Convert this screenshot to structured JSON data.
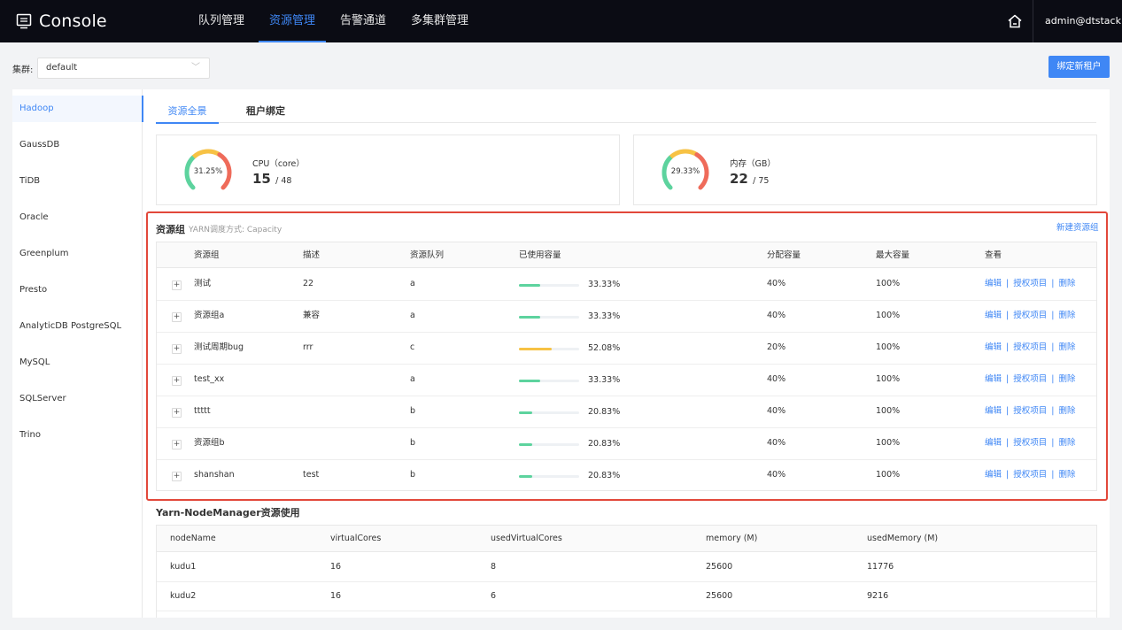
{
  "header": {
    "brand": "Console",
    "nav": [
      {
        "label": "队列管理",
        "active": false
      },
      {
        "label": "资源管理",
        "active": true
      },
      {
        "label": "告警通道",
        "active": false
      },
      {
        "label": "多集群管理",
        "active": false
      }
    ],
    "home_icon": "home-icon",
    "user": "admin@dtstack..."
  },
  "cluster": {
    "label": "集群:",
    "selected": "default",
    "bind_button": "绑定新租户"
  },
  "sidebar": {
    "items": [
      {
        "label": "Hadoop",
        "active": true
      },
      {
        "label": "GaussDB",
        "active": false
      },
      {
        "label": "TiDB",
        "active": false
      },
      {
        "label": "Oracle",
        "active": false
      },
      {
        "label": "Greenplum",
        "active": false
      },
      {
        "label": "Presto",
        "active": false
      },
      {
        "label": "AnalyticDB PostgreSQL",
        "active": false
      },
      {
        "label": "MySQL",
        "active": false
      },
      {
        "label": "SQLServer",
        "active": false
      },
      {
        "label": "Trino",
        "active": false
      }
    ]
  },
  "tabs": [
    {
      "label": "资源全景",
      "active": true
    },
    {
      "label": "租户绑定",
      "active": false
    }
  ],
  "metrics": [
    {
      "label": "CPU（core）",
      "used": "15",
      "total": "/ 48",
      "percent_text": "31.25%",
      "percent": 31.25
    },
    {
      "label": "内存（GB）",
      "used": "22",
      "total": "/ 75",
      "percent_text": "29.33%",
      "percent": 29.33
    }
  ],
  "resource_groups": {
    "title": "资源组",
    "subtitle": "YARN调度方式: Capacity",
    "new_button": "新建资源组",
    "columns": [
      "资源组",
      "描述",
      "资源队列",
      "已使用容量",
      "分配容量",
      "最大容量",
      "查看"
    ],
    "actions": {
      "edit": "编辑",
      "auth": "授权项目",
      "delete": "删除",
      "separator": "|"
    },
    "rows": [
      {
        "name": "测试",
        "desc": "22",
        "queue": "a",
        "used_text": "33.33%",
        "used": 33.33,
        "alloc": "40%",
        "max": "100%",
        "color": "#5dd39e"
      },
      {
        "name": "资源组a",
        "desc": "兼容",
        "queue": "a",
        "used_text": "33.33%",
        "used": 33.33,
        "alloc": "40%",
        "max": "100%",
        "color": "#5dd39e"
      },
      {
        "name": "测试周期bug",
        "desc": "rrr",
        "queue": "c",
        "used_text": "52.08%",
        "used": 52.08,
        "alloc": "20%",
        "max": "100%",
        "color": "#f7c244"
      },
      {
        "name": "test_xx",
        "desc": "",
        "queue": "a",
        "used_text": "33.33%",
        "used": 33.33,
        "alloc": "40%",
        "max": "100%",
        "color": "#5dd39e"
      },
      {
        "name": "ttttt",
        "desc": "",
        "queue": "b",
        "used_text": "20.83%",
        "used": 20.83,
        "alloc": "40%",
        "max": "100%",
        "color": "#5dd39e"
      },
      {
        "name": "资源组b",
        "desc": "",
        "queue": "b",
        "used_text": "20.83%",
        "used": 20.83,
        "alloc": "40%",
        "max": "100%",
        "color": "#5dd39e"
      },
      {
        "name": "shanshan",
        "desc": "test",
        "queue": "b",
        "used_text": "20.83%",
        "used": 20.83,
        "alloc": "40%",
        "max": "100%",
        "color": "#5dd39e"
      }
    ]
  },
  "node_manager": {
    "title": "Yarn-NodeManager资源使用",
    "columns": [
      "nodeName",
      "virtualCores",
      "usedVirtualCores",
      "memory (M)",
      "usedMemory (M)"
    ],
    "rows": [
      [
        "kudu1",
        "16",
        "8",
        "25600",
        "11776"
      ],
      [
        "kudu2",
        "16",
        "6",
        "25600",
        "9216"
      ]
    ]
  },
  "colors": {
    "accent": "#3f87f5",
    "highlight_border": "#e2483a",
    "gauge_green": "#5dd39e",
    "gauge_yellow": "#f7c244",
    "gauge_red": "#ef6b5a"
  }
}
